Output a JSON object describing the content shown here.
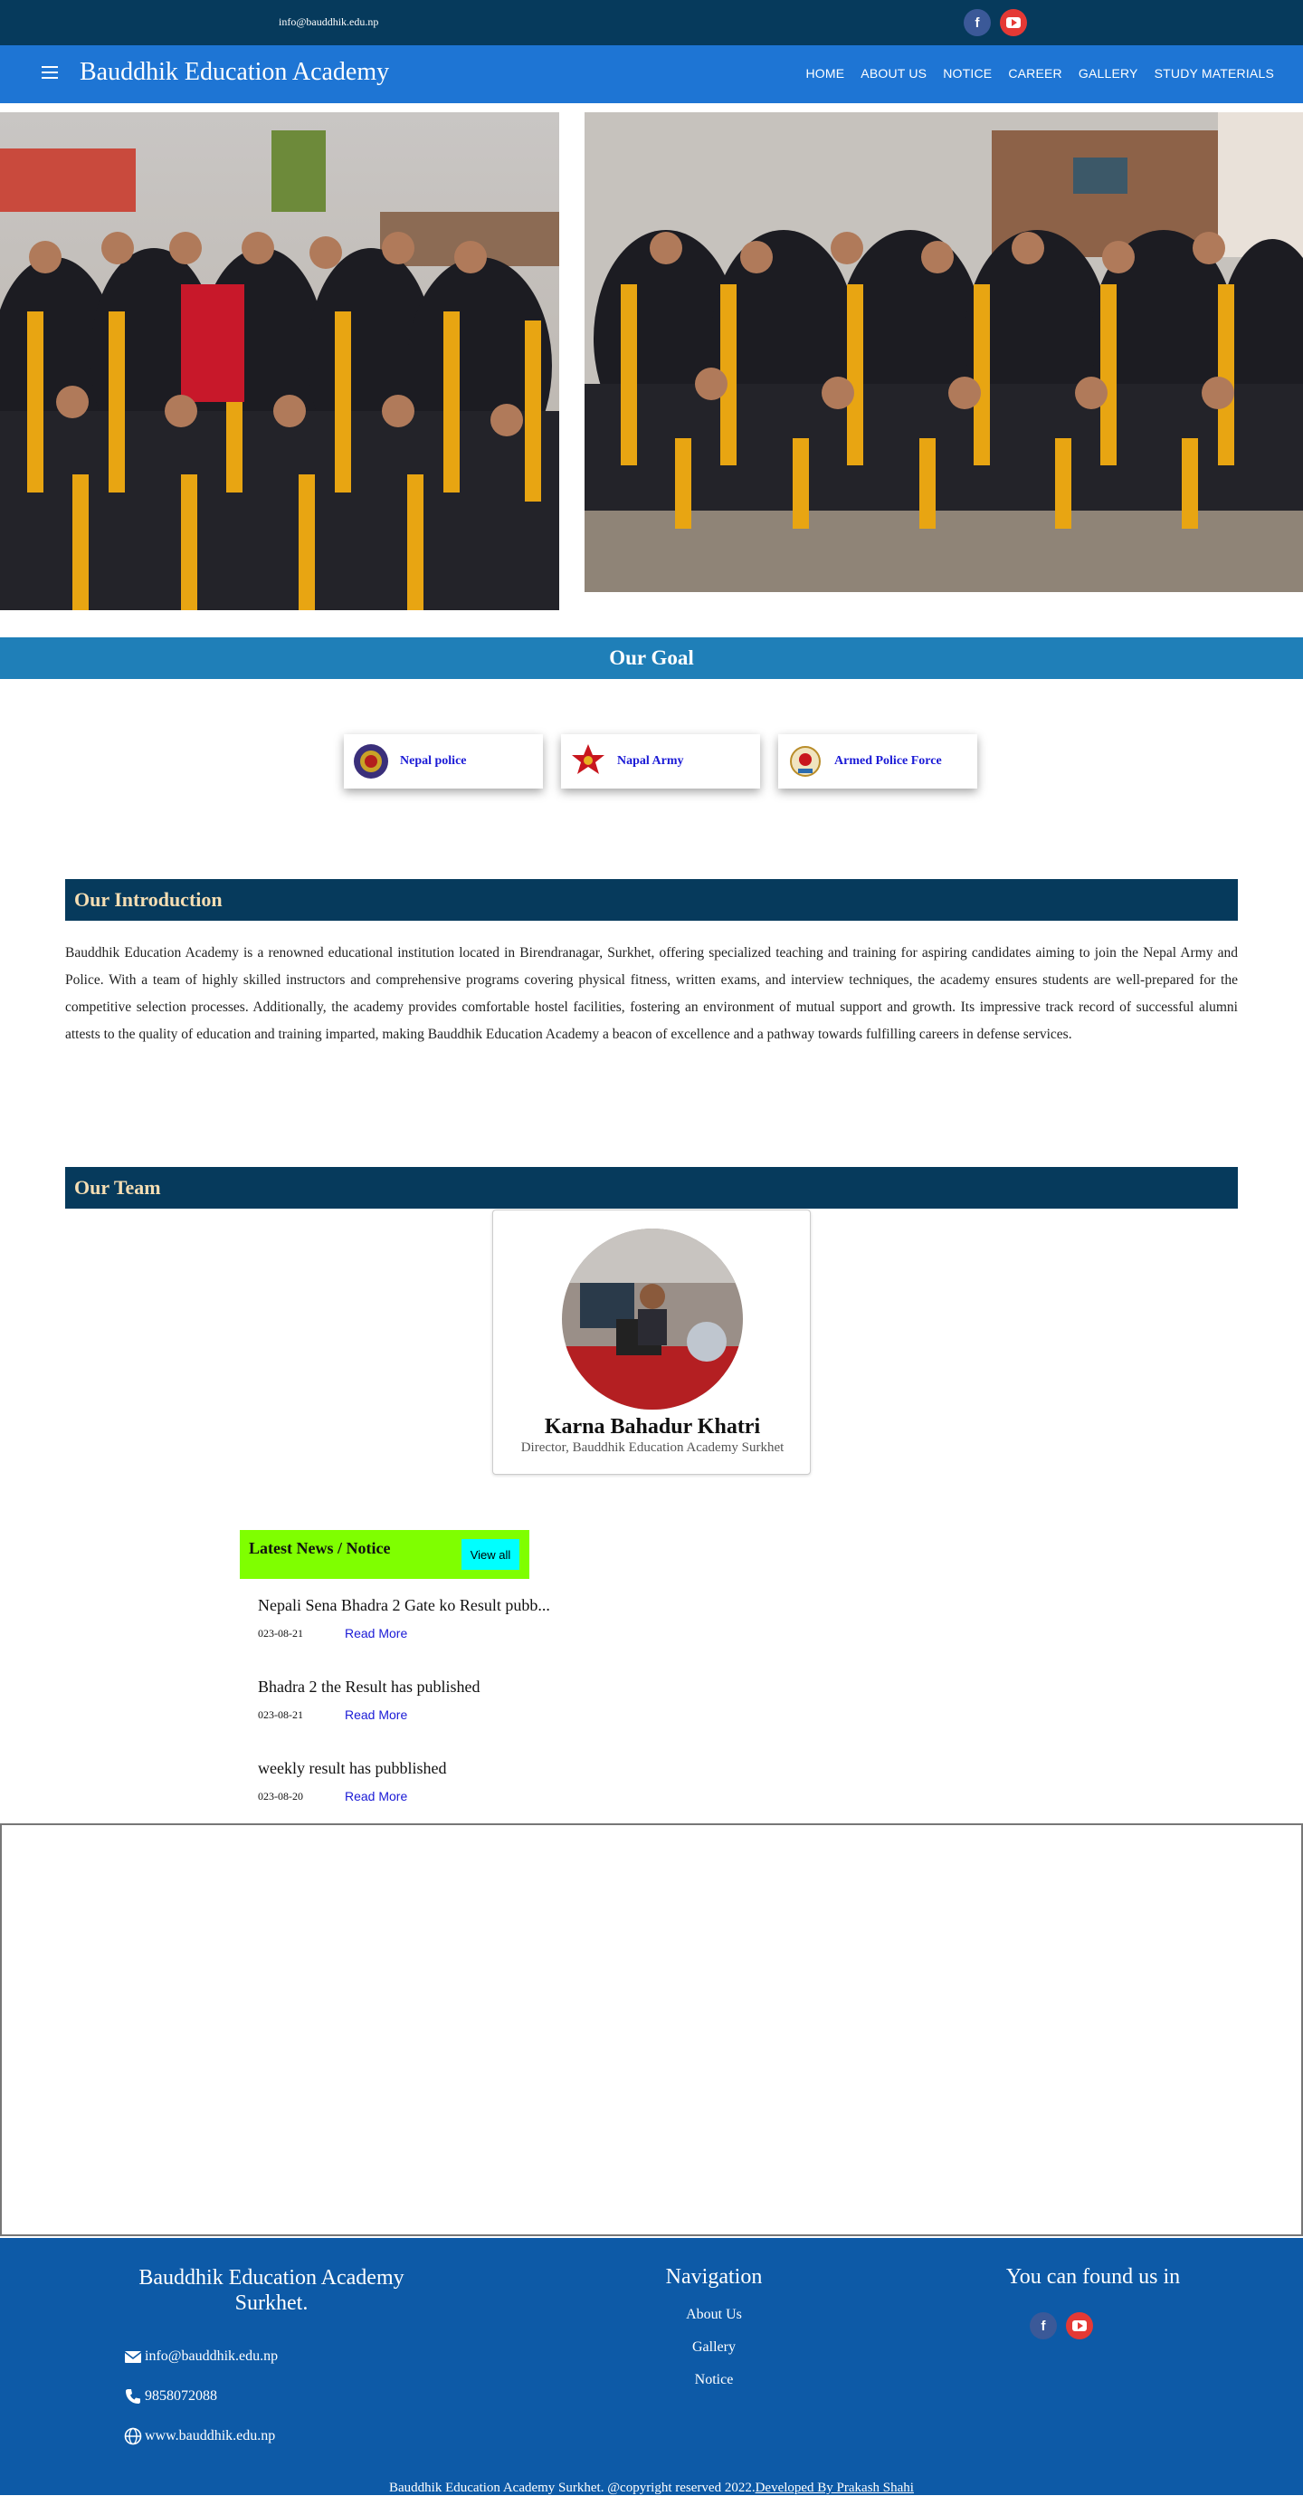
{
  "topbar": {
    "email": "info@bauddhik.edu.np",
    "social": [
      "facebook-icon",
      "youtube-icon"
    ]
  },
  "navbar": {
    "brand": "Bauddhik Education Academy",
    "links": [
      "HOME",
      "ABOUT US",
      "NOTICE",
      "CAREER",
      "GALLERY",
      "STUDY MATERIALS"
    ]
  },
  "goal": {
    "title": "Our Goal",
    "cards": [
      {
        "label": "Nepal police",
        "icon": "nepal-police-emblem"
      },
      {
        "label": "Napal Army",
        "icon": "nepal-army-emblem"
      },
      {
        "label": "Armed Police Force",
        "icon": "armed-police-emblem"
      }
    ]
  },
  "intro": {
    "title": "Our Introduction",
    "text": "Bauddhik Education Academy is a renowned educational institution located in Birendranagar, Surkhet, offering specialized teaching and training for aspiring candidates aiming to join the Nepal Army and Police. With a team of highly skilled instructors and comprehensive programs covering physical fitness, written exams, and interview techniques, the academy ensures students are well-prepared for the competitive selection processes. Additionally, the academy provides comfortable hostel facilities, fostering an environment of mutual support and growth. Its impressive track record of successful alumni attests to the quality of education and training imparted, making Bauddhik Education Academy a beacon of excellence and a pathway towards fulfilling careers in defense services."
  },
  "team": {
    "title": "Our Team",
    "member": {
      "name": "Karna Bahadur Khatri",
      "role": "Director, Bauddhik Education Academy Surkhet"
    }
  },
  "news": {
    "title": "Latest News / Notice",
    "view_all": "View all",
    "items": [
      {
        "title": "Nepali Sena Bhadra 2 Gate ko Result pubb...",
        "date": "023-08-21",
        "link": "Read More"
      },
      {
        "title": "Bhadra 2 the Result has published",
        "date": "023-08-21",
        "link": "Read More"
      },
      {
        "title": "weekly result has pubblished",
        "date": "023-08-20",
        "link": "Read More"
      }
    ]
  },
  "footer": {
    "org_line1": "Bauddhik Education Academy",
    "org_line2": "Surkhet.",
    "email": "info@bauddhik.edu.np",
    "phone": "9858072088",
    "website": "www.bauddhik.edu.np",
    "nav_title": "Navigation",
    "nav_links": [
      "About Us",
      "Gallery",
      "Notice"
    ],
    "social_title": "You can found us in",
    "copyright": "Bauddhik Education Academy Surkhet. @copyright reserved 2022.",
    "developer": "Developed By Prakash Shahi"
  },
  "colors": {
    "topbar": "#063a5c",
    "navbar": "#1e75d4",
    "goal_bar": "#1f7fb8",
    "section_head": "#063a5c",
    "news_head": "#7fff00",
    "view_all": "#00ffff",
    "footer": "#0d5aa7"
  }
}
